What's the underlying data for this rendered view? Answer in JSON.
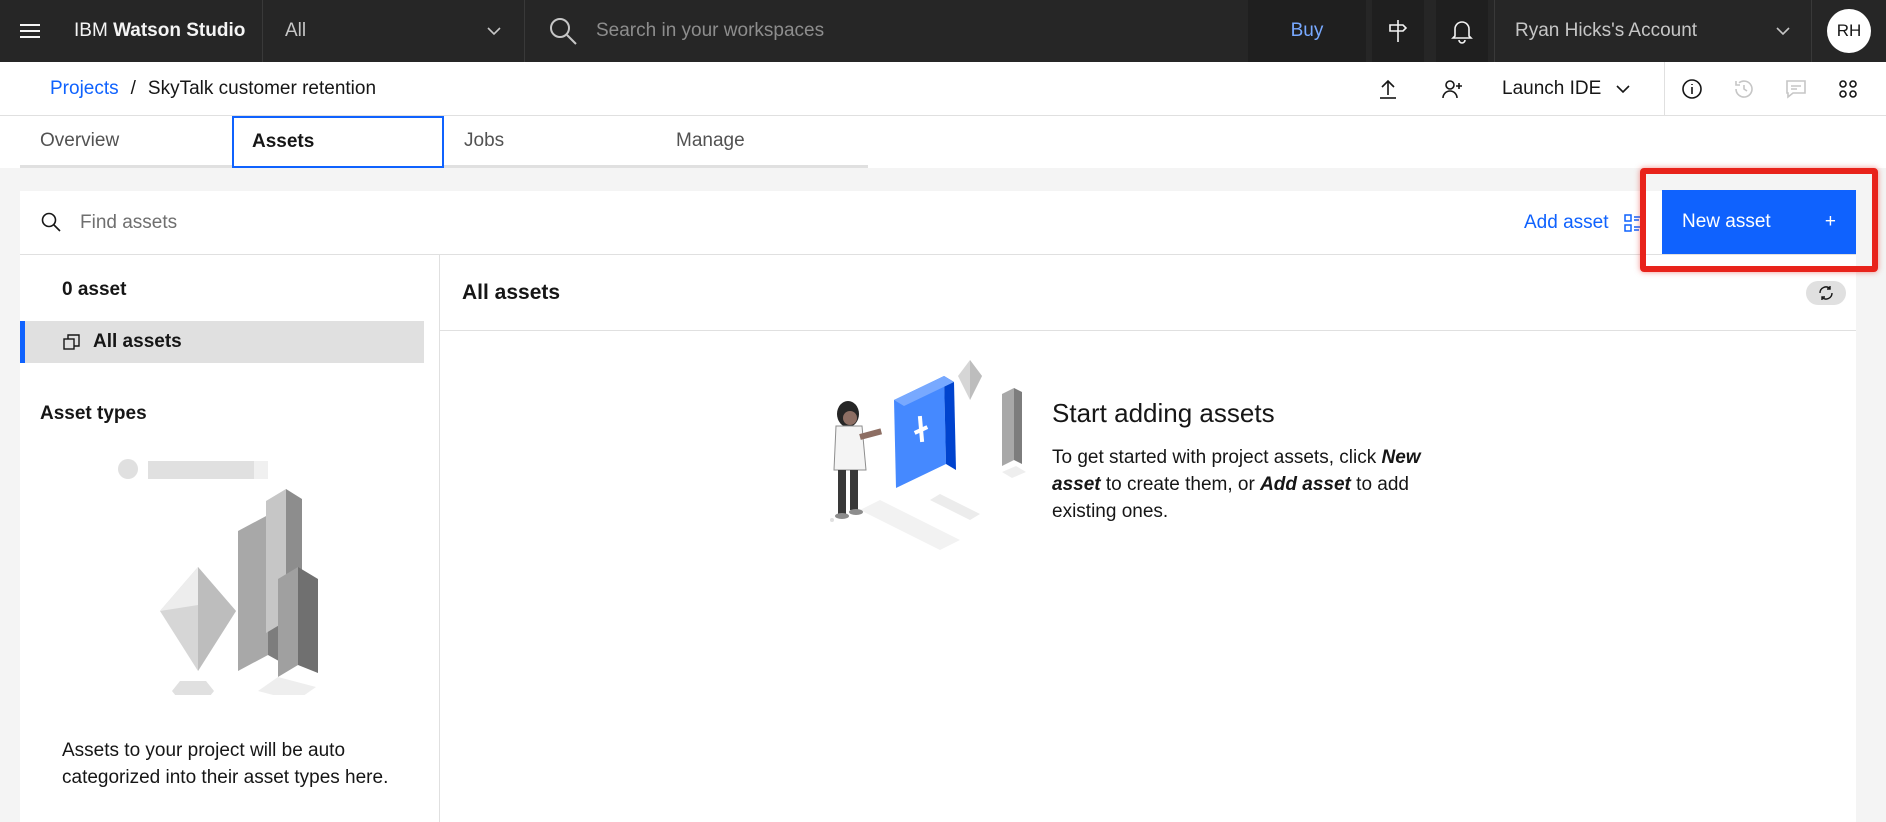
{
  "header": {
    "brand_prefix": "IBM ",
    "brand_name": "Watson Studio",
    "scope": "All",
    "search_placeholder": "Search in your workspaces",
    "buy": "Buy",
    "account": "Ryan Hicks's Account",
    "avatar": "RH"
  },
  "breadcrumb": {
    "root": "Projects",
    "separator": "/",
    "current": "SkyTalk customer retention"
  },
  "toolbar": {
    "launch": "Launch IDE"
  },
  "tabs": [
    {
      "label": "Overview"
    },
    {
      "label": "Assets"
    },
    {
      "label": "Jobs"
    },
    {
      "label": "Manage"
    }
  ],
  "assets": {
    "find_placeholder": "Find assets",
    "add_asset": "Add asset",
    "new_asset": "New asset",
    "new_asset_icon": "+",
    "count": "0 asset",
    "all_assets": "All assets",
    "asset_types": "Asset types",
    "types_desc": "Assets to your project will be auto categorized into their asset types here.",
    "content_title": "All assets",
    "empty_title": "Start adding assets",
    "empty_p1": "To get started with project assets, click ",
    "empty_new": "New asset",
    "empty_p2": " to create them, or ",
    "empty_add": "Add asset",
    "empty_p3": " to add existing ones."
  },
  "colors": {
    "header_bg": "#262626",
    "accent": "#0f62fe",
    "highlight": "#e8231b"
  }
}
